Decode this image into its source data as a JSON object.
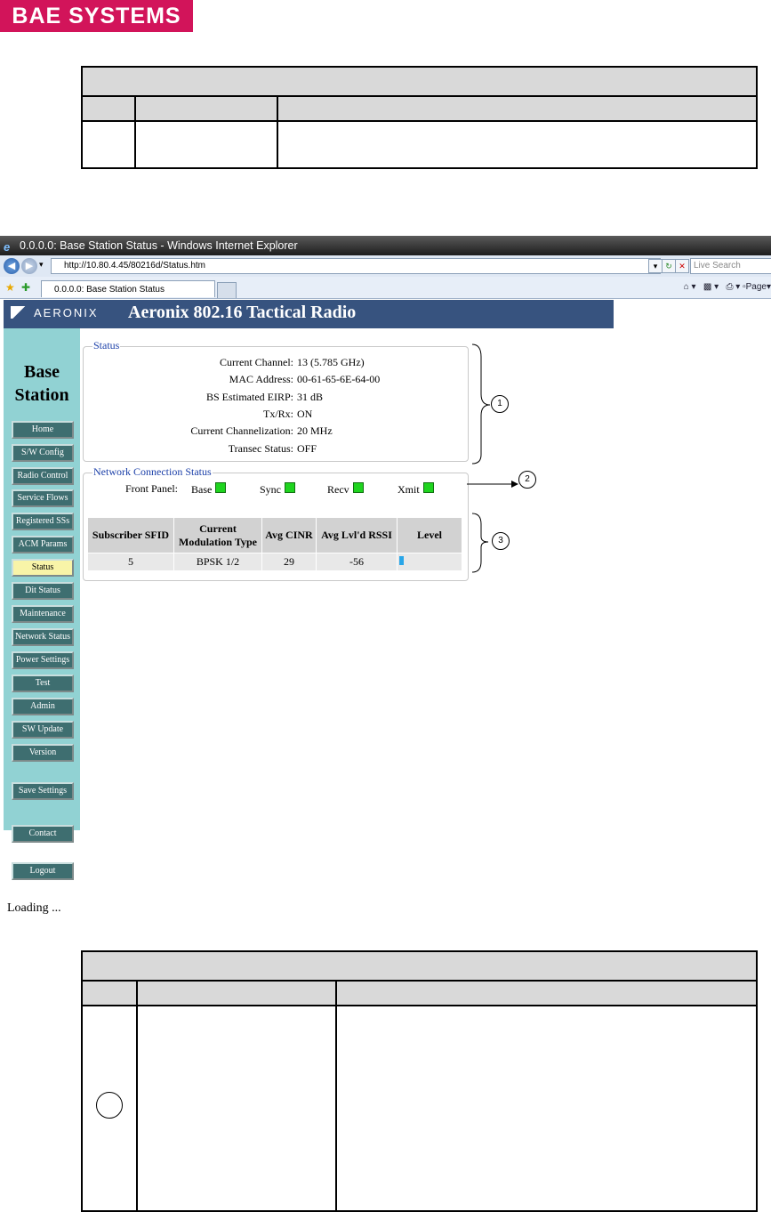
{
  "logo": {
    "text": "BAE SYSTEMS",
    "color": "#d2145a"
  },
  "browser": {
    "title": "0.0.0.0: Base Station Status - Windows Internet Explorer",
    "url": "http://10.80.4.45/80216d/Status.htm",
    "search_placeholder": "Live Search",
    "tab_label": "0.0.0.0: Base Station Status",
    "tools_label": "Page"
  },
  "page": {
    "brand": "AERONIX",
    "title": "Aeronix 802.16 Tactical Radio",
    "sidebar_title_1": "Base",
    "sidebar_title_2": "Station",
    "nav": [
      "Home",
      "S/W Config",
      "Radio Control",
      "Service Flows",
      "Registered SSs",
      "ACM Params",
      "Status",
      "Dit Status",
      "Maintenance",
      "Network Status",
      "Power Settings",
      "Test",
      "Admin",
      "SW Update",
      "Version"
    ],
    "save_label": "Save Settings",
    "contact_label": "Contact",
    "logout_label": "Logout",
    "loading_text": "Loading ..."
  },
  "status": {
    "legend": "Status",
    "rows": [
      {
        "label": "Current Channel:",
        "value": "13 (5.785 GHz)"
      },
      {
        "label": "MAC Address:",
        "value": "00-61-65-6E-64-00"
      },
      {
        "label": "BS Estimated EIRP:",
        "value": "31 dB"
      },
      {
        "label": "Tx/Rx:",
        "value": "ON"
      },
      {
        "label": "Current Channelization:",
        "value": "20 MHz"
      },
      {
        "label": "Transec Status:",
        "value": "OFF"
      }
    ]
  },
  "network": {
    "legend": "Network Connection Status",
    "front_panel_label": "Front Panel:",
    "leds": [
      "Base",
      "Sync",
      "Recv",
      "Xmit"
    ],
    "table_headers": [
      "Subscriber SFID",
      "Current Modulation Type",
      "Avg CINR",
      "Avg Lvl'd RSSI",
      "Level"
    ],
    "rows": [
      {
        "sfid": "5",
        "modulation": "BPSK 1/2",
        "cinr": "29",
        "rssi": "-56",
        "level": 0.08
      }
    ]
  },
  "callouts": [
    "1",
    "2",
    "3"
  ],
  "colors": {
    "header": "#37537f",
    "sidebar": "#91d2d3",
    "nav_button": "#3e6e70",
    "active_nav": "#f8f4a8",
    "led": "#1fd41f"
  }
}
